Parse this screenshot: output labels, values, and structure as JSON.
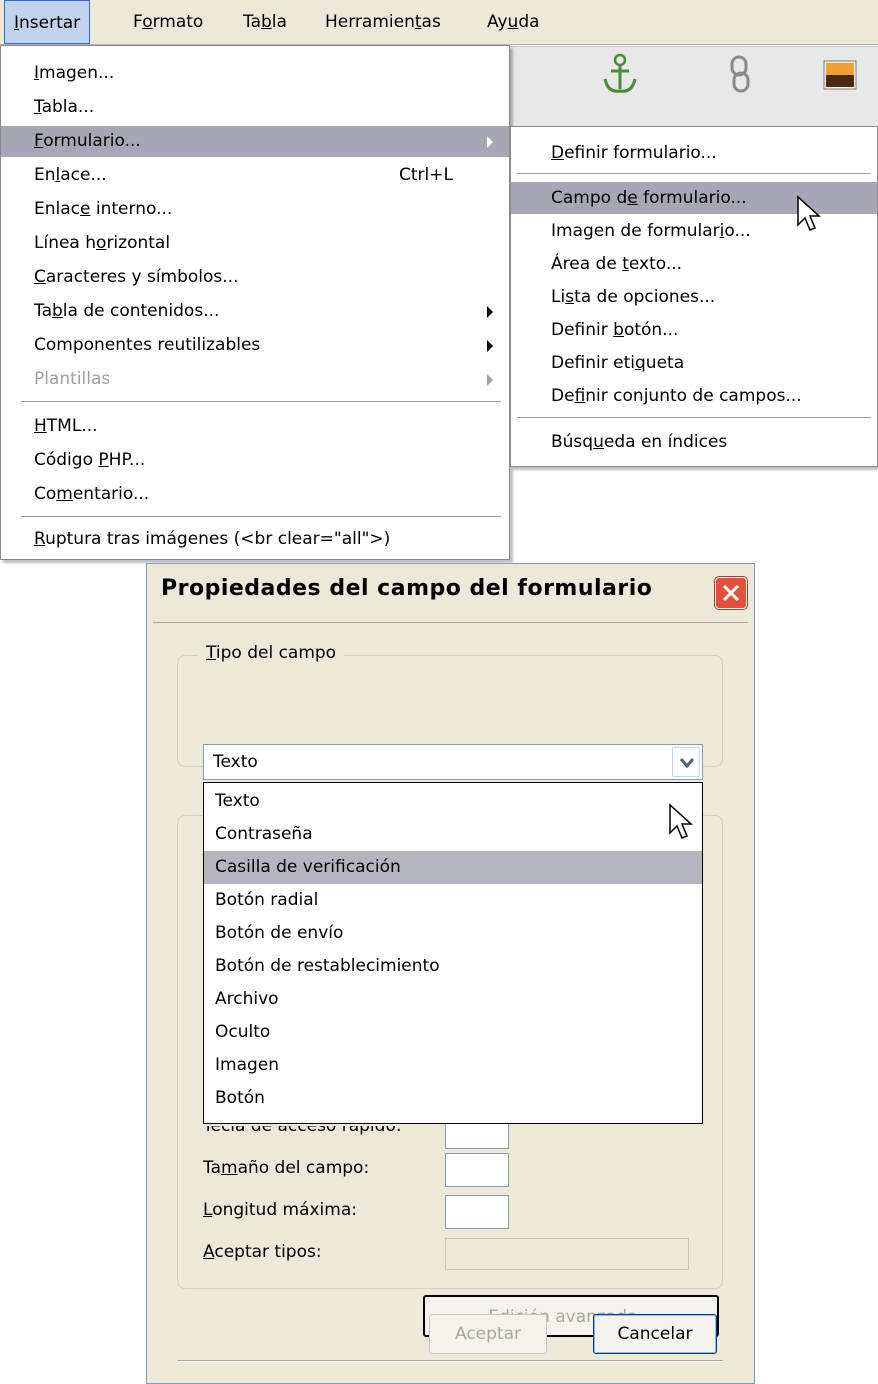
{
  "menubar": {
    "items": [
      {
        "label": "Insertar",
        "accel": "I",
        "rest": "nsertar"
      },
      {
        "label": "Formato",
        "pre": "F",
        "accel": "o",
        "rest": "rmato"
      },
      {
        "label": "Tabla",
        "pre": "Ta",
        "accel": "b",
        "rest": "la"
      },
      {
        "label": "Herramientas",
        "pre": "Herramien",
        "accel": "t",
        "rest": "as"
      },
      {
        "label": "Ayuda",
        "pre": "Ay",
        "accel": "u",
        "rest": "da"
      }
    ]
  },
  "toolbar": {
    "enlace_interno": "Enlace interno",
    "enlace": "Enlace",
    "imagen": "Imagen"
  },
  "insert_menu": {
    "items": [
      {
        "pre": "",
        "accel": "I",
        "rest": "magen..."
      },
      {
        "pre": "",
        "accel": "T",
        "rest": "abla..."
      },
      {
        "pre": "",
        "accel": "F",
        "rest": "ormulario..."
      },
      {
        "pre": "En",
        "accel": "l",
        "rest": "ace..."
      },
      {
        "pre": "Enlac",
        "accel": "e",
        "rest": " interno..."
      },
      {
        "pre": "Línea h",
        "accel": "o",
        "rest": "rizontal"
      },
      {
        "pre": "",
        "accel": "C",
        "rest": "aracteres y símbolos..."
      },
      {
        "pre": "Ta",
        "accel": "b",
        "rest": "la de contenidos..."
      },
      {
        "pre": "Componentes reutilizables",
        "accel": "",
        "rest": ""
      },
      {
        "pre": "Plantillas",
        "accel": "",
        "rest": ""
      },
      {
        "pre": "",
        "accel": "H",
        "rest": "TML..."
      },
      {
        "pre": "Código ",
        "accel": "P",
        "rest": "HP..."
      },
      {
        "pre": "Co",
        "accel": "m",
        "rest": "entario..."
      },
      {
        "pre": "",
        "accel": "R",
        "rest": "uptura tras imágenes (<br clear=\"all\">)"
      }
    ],
    "enlace_shortcut": "Ctrl+L"
  },
  "form_submenu": {
    "items": [
      {
        "pre": "",
        "accel": "D",
        "rest": "efinir formulario..."
      },
      {
        "pre": "Campo d",
        "accel": "e",
        "rest": " formulario..."
      },
      {
        "pre": "Imagen de formular",
        "accel": "i",
        "rest": "o..."
      },
      {
        "pre": "Área de ",
        "accel": "t",
        "rest": "exto..."
      },
      {
        "pre": "Li",
        "accel": "s",
        "rest": "ta de opciones..."
      },
      {
        "pre": "Definir ",
        "accel": "b",
        "rest": "otón..."
      },
      {
        "pre": "Definir eti",
        "accel": "q",
        "rest": "ueta"
      },
      {
        "pre": "De",
        "accel": "f",
        "rest": "inir conjunto de campos..."
      },
      {
        "pre": "Búsq",
        "accel": "u",
        "rest": "eda en índices"
      }
    ]
  },
  "dialog": {
    "title": "Propiedades del campo del formulario",
    "group_tipo": {
      "accel": "T",
      "rest": "ipo del campo"
    },
    "selected_type": "Texto",
    "type_options": [
      "Texto",
      "Contraseña",
      "Casilla de verificación",
      "Botón radial",
      "Botón de envío",
      "Botón de restablecimiento",
      "Archivo",
      "Oculto",
      "Imagen",
      "Botón"
    ],
    "tecla_partial": "Tecla de acceso rápido:",
    "tamano": {
      "pre": "Ta",
      "accel": "m",
      "rest": "año del campo:"
    },
    "longitud": {
      "pre": "",
      "accel": "L",
      "rest": "ongitud máxima:"
    },
    "aceptar_tipos": {
      "pre": "",
      "accel": "A",
      "rest": "ceptar tipos:"
    },
    "edicion_avanzada": {
      "pre": "",
      "accel": "E",
      "rest": "dición avanzada..."
    },
    "aceptar_label": "Aceptar",
    "cancelar_label": "Cancelar"
  }
}
